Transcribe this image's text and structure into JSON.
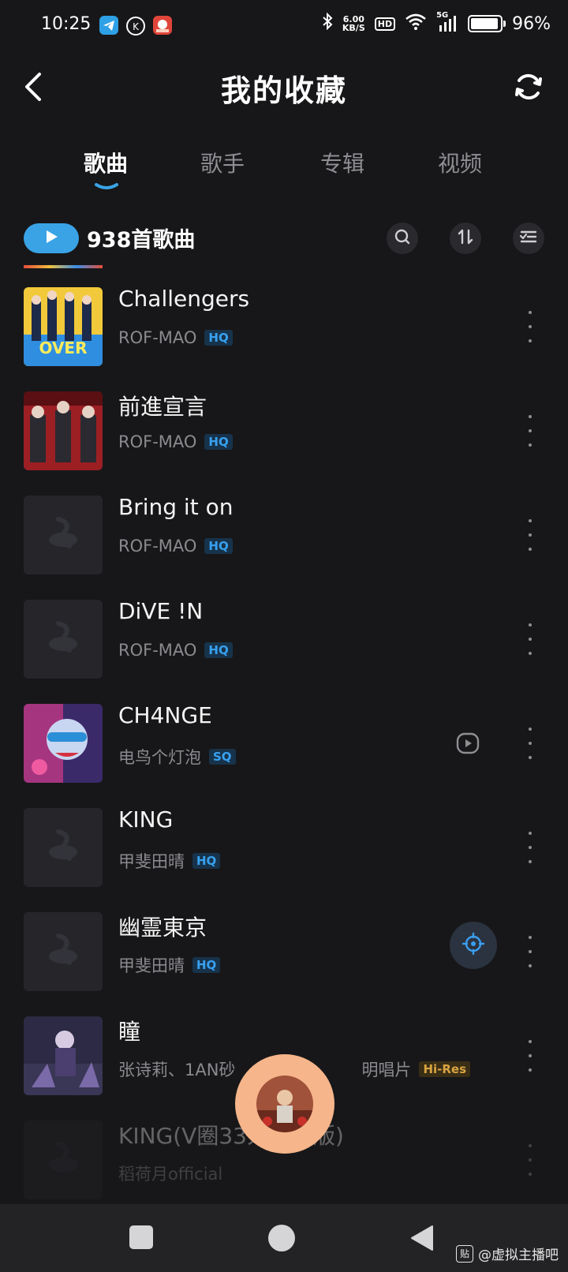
{
  "status_bar": {
    "time": "10:25",
    "net_speed_value": "6.00",
    "net_speed_unit": "KB/S",
    "hd_label": "HD",
    "signal_label": "5G",
    "battery_percent": "96%",
    "battery_level": 0.96,
    "app_icons": [
      "telegram-icon",
      "k-app-icon",
      "red-app-icon"
    ]
  },
  "header": {
    "title": "我的收藏",
    "back_icon": "chevron-left-icon",
    "refresh_icon": "refresh-icon"
  },
  "tabs": [
    {
      "label": "歌曲",
      "active": true
    },
    {
      "label": "歌手",
      "active": false
    },
    {
      "label": "专辑",
      "active": false
    },
    {
      "label": "视频",
      "active": false
    }
  ],
  "summary": {
    "count_text": "938首歌曲",
    "accent_color": "#3aa3e6",
    "actions": [
      "search-icon",
      "sort-icon",
      "multi-select-icon"
    ]
  },
  "songs": [
    {
      "title": "Challengers",
      "artist": "ROF-MAO",
      "quality": "HQ",
      "cover": "art"
    },
    {
      "title": "前進宣言",
      "artist": "ROF-MAO",
      "quality": "HQ",
      "cover": "art"
    },
    {
      "title": "Bring it on",
      "artist": "ROF-MAO",
      "quality": "HQ",
      "cover": "placeholder"
    },
    {
      "title": "DiVE !N",
      "artist": "ROF-MAO",
      "quality": "HQ",
      "cover": "placeholder"
    },
    {
      "title": "CH4NGE",
      "artist": "电鸟个灯泡",
      "quality": "SQ",
      "cover": "art",
      "has_mv": true
    },
    {
      "title": "KING",
      "artist": "甲斐田晴",
      "quality": "HQ",
      "cover": "placeholder"
    },
    {
      "title": "幽霊東京",
      "artist": "甲斐田晴",
      "quality": "HQ",
      "cover": "placeholder",
      "locate_button": true
    },
    {
      "title": "瞳",
      "artist": "张诗莉、1AN砂",
      "artist_tail": "明唱片",
      "quality": "Hi-Res",
      "cover": "art"
    },
    {
      "title": "KING(V圈33人合唱版)",
      "artist": "稻荷月official",
      "quality": "",
      "cover": "placeholder"
    }
  ],
  "mini_player": {
    "color": "#f6b58a"
  },
  "nav_bar": {
    "icons": [
      "recents-icon",
      "home-icon",
      "back-icon"
    ]
  },
  "watermark": {
    "logo": "贴",
    "text": "@虚拟主播吧"
  }
}
